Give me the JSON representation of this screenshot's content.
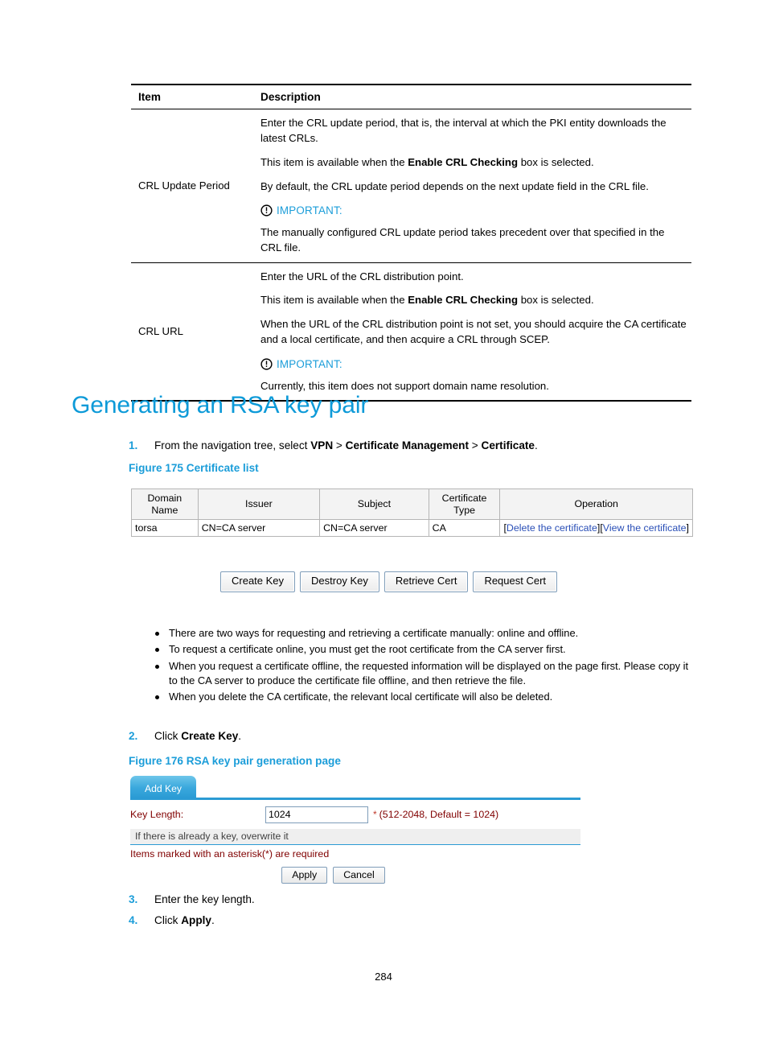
{
  "reference_table": {
    "headers": {
      "item": "Item",
      "description": "Description"
    },
    "rows": [
      {
        "item": "CRL Update Period",
        "paragraphs": [
          "Enter the CRL update period, that is, the interval at which the PKI entity downloads the latest CRLs.",
          "This item is available when the Enable CRL Checking box is selected.",
          "By default, the CRL update period depends on the next update field in the CRL file."
        ],
        "bold_terms": [
          "Enable CRL Checking"
        ],
        "important_label": "IMPORTANT:",
        "important_text": "The manually configured CRL update period takes precedent over that specified in the CRL file."
      },
      {
        "item": "CRL URL",
        "paragraphs": [
          "Enter the URL of the CRL distribution point.",
          "This item is available when the Enable CRL Checking box is selected.",
          "When the URL of the CRL distribution point is not set, you should acquire the CA certificate and a local certificate, and then acquire a CRL through SCEP."
        ],
        "bold_terms": [
          "Enable CRL Checking"
        ],
        "important_label": "IMPORTANT:",
        "important_text": "Currently, this item does not support domain name resolution."
      }
    ]
  },
  "section": {
    "heading": "Generating an RSA key pair"
  },
  "steps": {
    "step1": {
      "number": "1.",
      "prefix": "From the navigation tree, select ",
      "b1": "VPN",
      "sep1": " > ",
      "b2": "Certificate Management",
      "sep2": " > ",
      "b3": "Certificate",
      "suffix": "."
    },
    "step2": {
      "number": "2.",
      "prefix": "Click ",
      "b1": "Create Key",
      "suffix": "."
    },
    "step3": {
      "number": "3.",
      "text": "Enter the key length."
    },
    "step4": {
      "number": "4.",
      "prefix": "Click ",
      "b1": "Apply",
      "suffix": "."
    }
  },
  "figures": {
    "fig175_caption": "Figure 175 Certificate list",
    "fig176_caption": "Figure 176 RSA key pair generation page"
  },
  "certificate_list": {
    "columns": [
      "Domain Name",
      "Issuer",
      "Subject",
      "Certificate Type",
      "Operation"
    ],
    "column_lines": [
      [
        "Domain",
        "Name"
      ],
      [
        "Issuer"
      ],
      [
        "Subject"
      ],
      [
        "Certificate",
        "Type"
      ],
      [
        "Operation"
      ]
    ],
    "rows": [
      {
        "domain_name": "torsa",
        "issuer": "CN=CA server",
        "subject": "CN=CA server",
        "certificate_type": "CA",
        "operations": [
          "Delete the certificate",
          "View the certificate"
        ]
      }
    ],
    "buttons": [
      "Create Key",
      "Destroy Key",
      "Retrieve Cert",
      "Request Cert"
    ],
    "notes": [
      "There are two ways for requesting and retrieving a certificate manually: online and offline.",
      "To request a certificate online, you must get the root certificate from the CA server first.",
      "When you request a certificate offline, the requested information will be displayed on the page first. Please copy it to the CA server to produce the certificate file offline, and then retrieve the file.",
      "When you delete the CA certificate, the relevant local certificate will also be deleted."
    ]
  },
  "add_key_form": {
    "tab_label": "Add Key",
    "key_length_label": "Key Length:",
    "key_length_value": "1024",
    "required_marker": "*",
    "range_hint": "(512-2048, Default = 1024)",
    "overwrite_note": "If there is already a key, overwrite it",
    "asterisk_note": "Items marked with an asterisk(*) are required",
    "apply_button": "Apply",
    "cancel_button": "Cancel"
  },
  "footer": {
    "page_number": "284"
  },
  "colors": {
    "accent_blue": "#1b9dd9",
    "heading_blue": "#0d9ad8",
    "link_blue": "#2a4fb7",
    "form_label_maroon": "#800000",
    "required_red": "#c0392b",
    "tab_blue": "#2b9bd4"
  }
}
